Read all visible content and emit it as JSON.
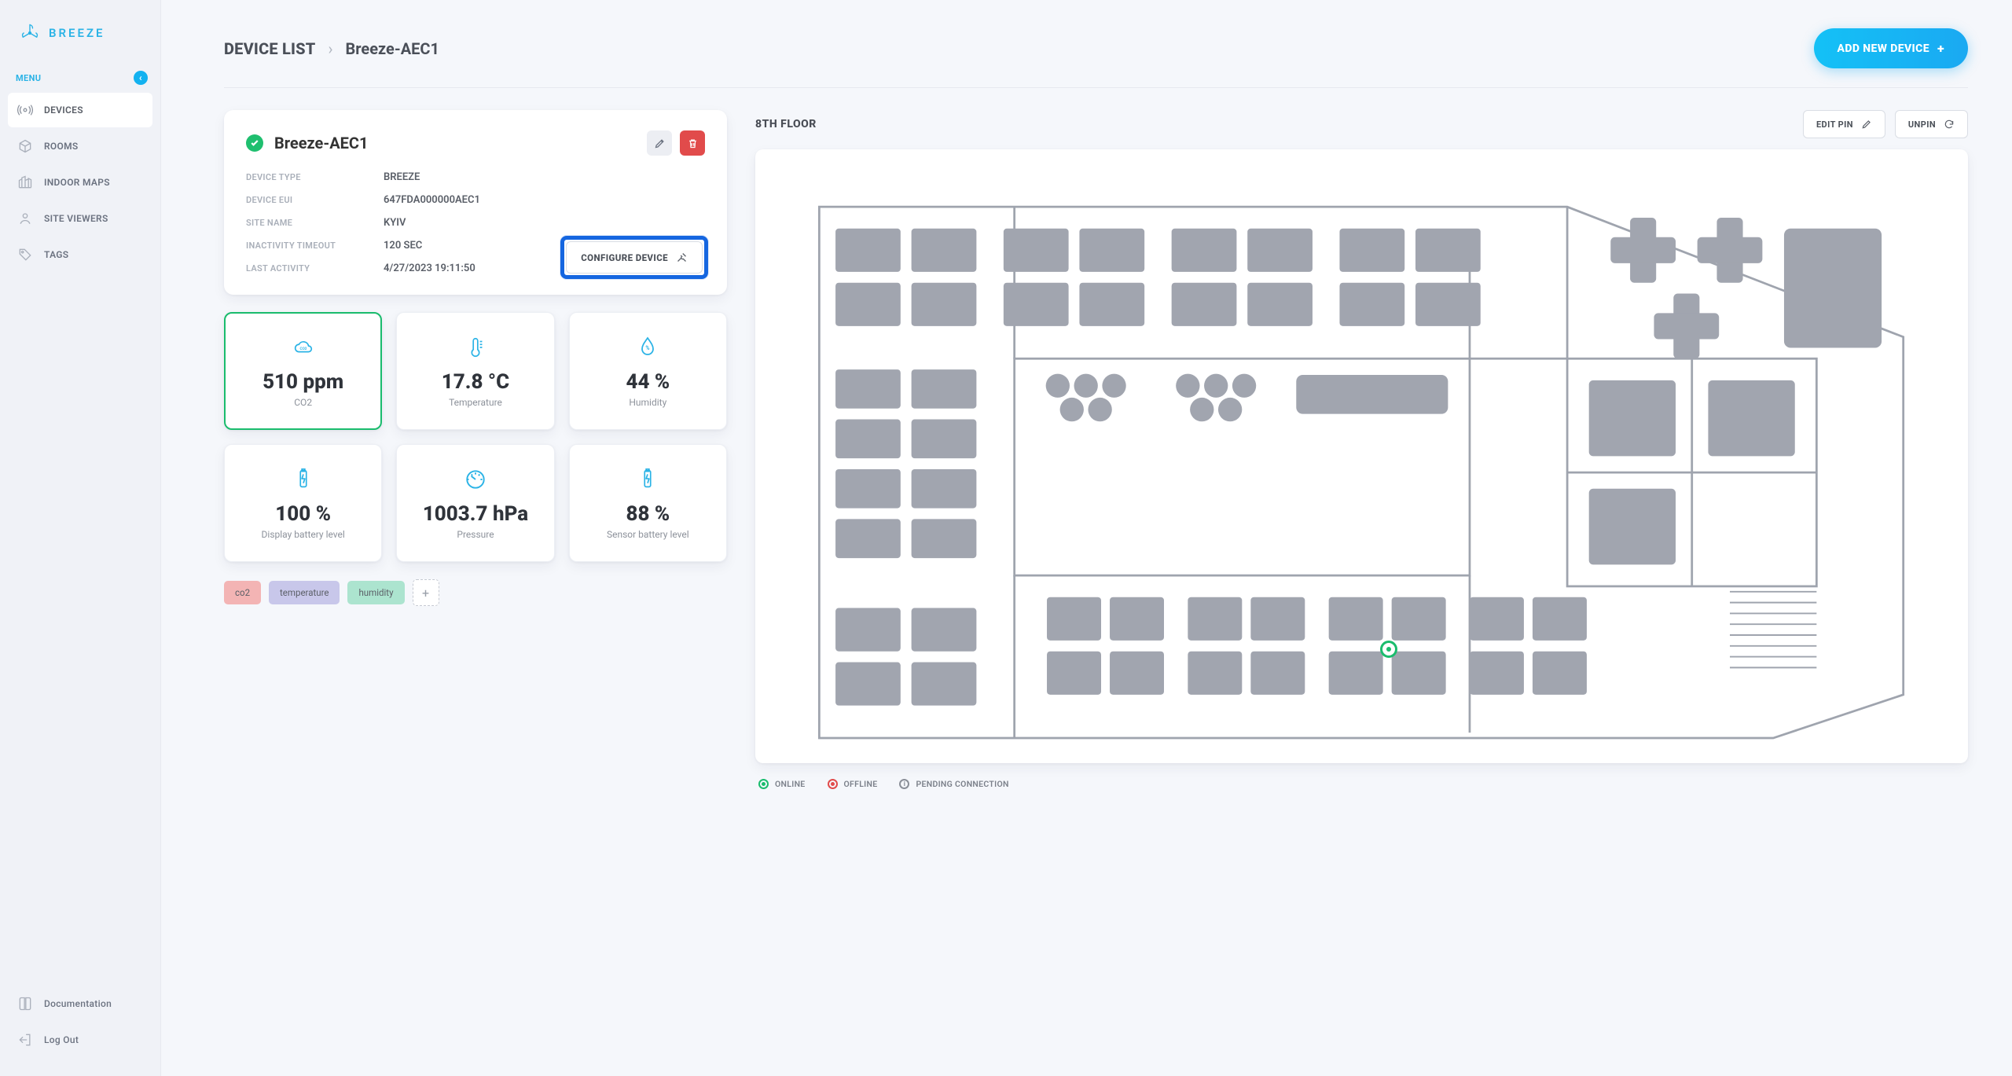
{
  "brand": "BREEZE",
  "sidebar": {
    "menu_label": "MENU",
    "items": [
      {
        "label": "DEVICES",
        "icon": "broadcast-icon",
        "active": true
      },
      {
        "label": "ROOMS",
        "icon": "cube-icon",
        "active": false
      },
      {
        "label": "INDOOR MAPS",
        "icon": "city-icon",
        "active": false
      },
      {
        "label": "SITE VIEWERS",
        "icon": "user-icon",
        "active": false
      },
      {
        "label": "TAGS",
        "icon": "tag-icon",
        "active": false
      }
    ],
    "bottom": [
      {
        "label": "Documentation",
        "icon": "book-icon"
      },
      {
        "label": "Log Out",
        "icon": "logout-icon"
      }
    ]
  },
  "breadcrumb": {
    "parent": "DEVICE LIST",
    "current": "Breeze-AEC1"
  },
  "actions": {
    "add_new_device": "ADD NEW DEVICE"
  },
  "device": {
    "name": "Breeze-AEC1",
    "status": "online",
    "meta": [
      {
        "label": "DEVICE TYPE",
        "value": "BREEZE"
      },
      {
        "label": "DEVICE EUI",
        "value": "647FDA000000AEC1"
      },
      {
        "label": "SITE NAME",
        "value": "KYIV"
      },
      {
        "label": "INACTIVITY TIMEOUT",
        "value": "120 SEC"
      },
      {
        "label": "LAST ACTIVITY",
        "value": "4/27/2023 19:11:50"
      }
    ],
    "configure_label": "CONFIGURE DEVICE"
  },
  "metrics": [
    {
      "icon": "co2-icon",
      "value": "510 ppm",
      "label": "CO2",
      "active": true
    },
    {
      "icon": "thermometer-icon",
      "value": "17.8 °C",
      "label": "Temperature",
      "active": false
    },
    {
      "icon": "droplet-icon",
      "value": "44 %",
      "label": "Humidity",
      "active": false
    },
    {
      "icon": "battery-icon",
      "value": "100 %",
      "label": "Display battery level",
      "active": false
    },
    {
      "icon": "gauge-icon",
      "value": "1003.7 hPa",
      "label": "Pressure",
      "active": false
    },
    {
      "icon": "battery-icon",
      "value": "88 %",
      "label": "Sensor battery level",
      "active": false
    }
  ],
  "tags": [
    {
      "label": "co2",
      "color": "red"
    },
    {
      "label": "temperature",
      "color": "purple"
    },
    {
      "label": "humidity",
      "color": "green"
    }
  ],
  "floor": {
    "title": "8TH FLOOR",
    "edit_pin": "EDIT PIN",
    "unpin": "UNPIN"
  },
  "legend": {
    "online": "ONLINE",
    "offline": "OFFLINE",
    "pending": "PENDING CONNECTION"
  }
}
